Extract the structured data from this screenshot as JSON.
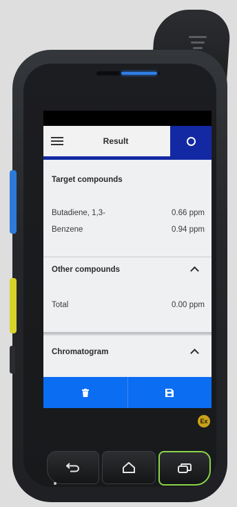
{
  "app_bar": {
    "title": "Result",
    "menu_icon": "hamburger-menu-icon",
    "status_icon": "status-ring-icon",
    "accent_color": "#1329a3"
  },
  "target_compounds": {
    "title": "Target compounds",
    "rows": [
      {
        "name": "Butadiene, 1,3-",
        "value": "0.66 ppm"
      },
      {
        "name": "Benzene",
        "value": "0.94 ppm"
      }
    ]
  },
  "other_compounds": {
    "title": "Other compounds",
    "rows": [
      {
        "name": "Total",
        "value": "0.00 ppm"
      }
    ]
  },
  "chromatogram": {
    "title": "Chromatogram"
  },
  "bottom_bar": {
    "color": "#0b6df2",
    "buttons": [
      {
        "icon": "trash-icon"
      },
      {
        "icon": "save-icon"
      }
    ]
  },
  "hardware": {
    "ex_badge": "Ex",
    "buttons": [
      "back-arrow-icon",
      "home-icon",
      "recent-apps-icon"
    ]
  }
}
